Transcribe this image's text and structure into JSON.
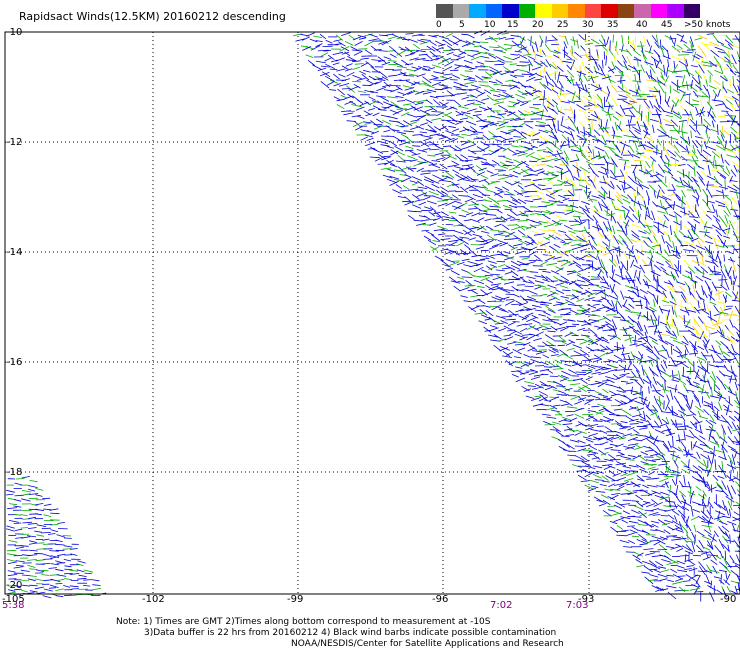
{
  "title": "Rapidsact Winds(12.5KM) 20160212 descending",
  "legend": {
    "labels": [
      "0",
      "5",
      "10",
      "15",
      "20",
      "25",
      "30",
      "35",
      "40",
      "45",
      ">50 knots"
    ],
    "colors": [
      "#555555",
      "#aaaaaa",
      "#00aaff",
      "#0066ff",
      "#0000cc",
      "#00b000",
      "#ffff00",
      "#ffcc00",
      "#ff8800",
      "#ff4444",
      "#dd0000",
      "#8b4513",
      "#cc66aa",
      "#ff00ff",
      "#aa00ff",
      "#330066"
    ]
  },
  "axes": {
    "lat_labels": [
      "-10",
      "-12",
      "-14",
      "-16",
      "-18",
      "-20"
    ],
    "lon_labels": [
      "-105",
      "-102",
      "-99",
      "-96",
      "-93",
      "-90"
    ],
    "lat_range": [
      -20,
      -10
    ],
    "lon_range": [
      -105,
      -90
    ],
    "grid": "dotted"
  },
  "time_labels": [
    "5:38",
    "7:02",
    "7:03"
  ],
  "notes": {
    "line1": "Note: 1) Times are GMT 2)Times along bottom correspond to measurement at -10S",
    "line2": "3)Data buffer is 22 hrs from 20160212 4) Black wind barbs indicate possible contamination",
    "line3": "NOAA/NESDIS/Center for Satellite Applications and Research"
  },
  "swath_colors": {
    "low": "#0000dd",
    "mid": "#00b000",
    "high": "#ffff00",
    "higher": "#ffcc00"
  }
}
